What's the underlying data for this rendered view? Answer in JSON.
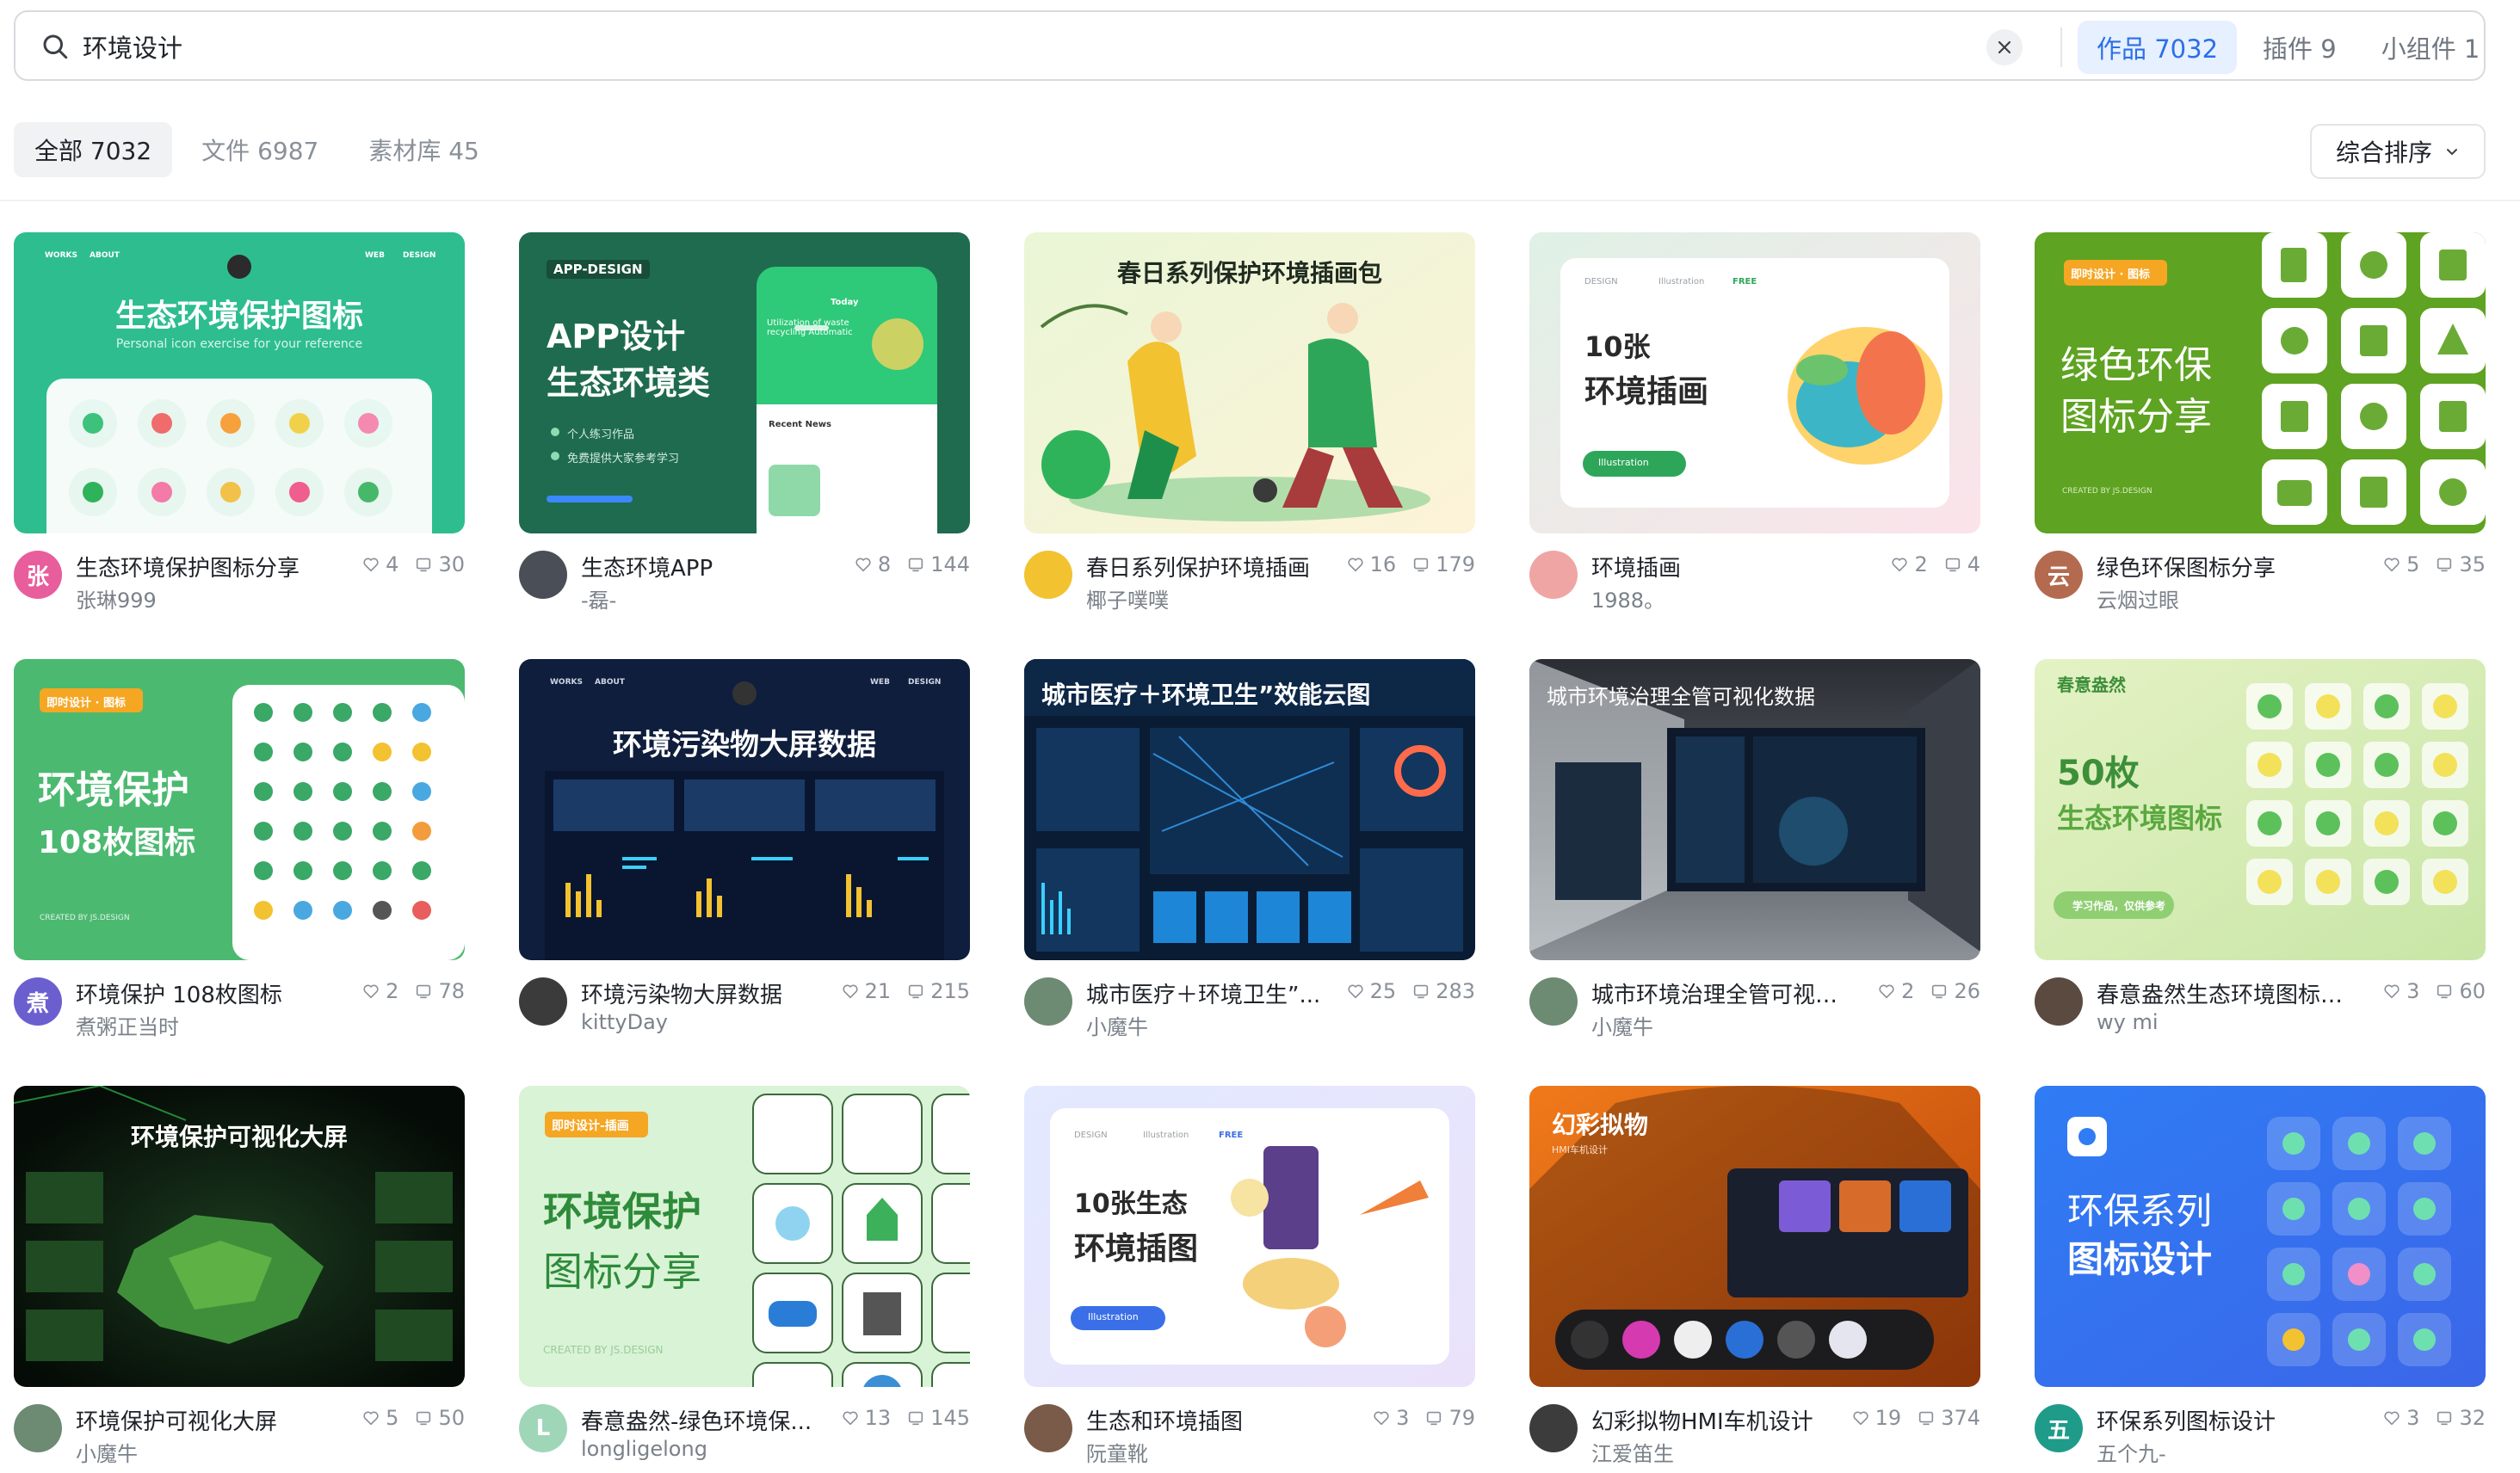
{
  "search": {
    "value": "环境设计",
    "placeholder": ""
  },
  "type_tabs": [
    {
      "label": "作品 7032",
      "active": true
    },
    {
      "label": "插件 9",
      "active": false
    },
    {
      "label": "小组件 1",
      "active": false
    }
  ],
  "filter_tabs": [
    {
      "label": "全部 7032",
      "active": true
    },
    {
      "label": "文件 6987",
      "active": false
    },
    {
      "label": "素材库 45",
      "active": false
    }
  ],
  "sort": {
    "label": "综合排序"
  },
  "colors": {
    "accent": "#2b6fe8",
    "accent_bg": "#e6f0ff"
  },
  "cards": [
    {
      "title": "生态环境保护图标分享",
      "author": "张琳999",
      "likes": "4",
      "comments": "30",
      "avatar_text": "张",
      "avatar_color": "#e85d9c",
      "thumb": {
        "heading": "生态环境保护图标",
        "sub": "Personal icon exercise for your reference",
        "nav": [
          "WORKS",
          "ABOUT",
          "WEB",
          "DESIGN"
        ]
      }
    },
    {
      "title": "生态环境APP",
      "author": "-磊-",
      "likes": "8",
      "comments": "144",
      "avatar_text": "",
      "avatar_color": "#4a4f57",
      "thumb": {
        "tag": "APP-DESIGN",
        "heading_1": "APP设计",
        "heading_2": "生态环境类",
        "bullet_1": "个人练习作品",
        "bullet_2": "免费提供大家参考学习",
        "phone_top": "Today",
        "phone_text": "Utilization of waste recycling Automatic",
        "phone_news": "Recent News"
      }
    },
    {
      "title": "春日系列保护环境插画",
      "author": "椰子噗噗",
      "likes": "16",
      "comments": "179",
      "avatar_text": "",
      "avatar_color": "#f2c230",
      "thumb": {
        "heading": "春日系列保护环境插画包"
      }
    },
    {
      "title": "环境插画",
      "author": "1988。",
      "likes": "2",
      "comments": "4",
      "avatar_text": "",
      "avatar_color": "#f0a5a5",
      "thumb": {
        "nav": [
          "DESIGN",
          "Illustration",
          "FREE"
        ],
        "heading_1": "10张",
        "heading_2": "环境插画",
        "button": "Illustration"
      }
    },
    {
      "title": "绿色环保图标分享",
      "author": "云烟过眼",
      "likes": "5",
      "comments": "35",
      "avatar_text": "云",
      "avatar_color": "#b36a4f",
      "thumb": {
        "tag": "即时设计 · 图标",
        "heading_1": "绿色环保",
        "heading_2": "图标分享",
        "footer": "CREATED BY JS.DESIGN"
      }
    },
    {
      "title": "环境保护 108枚图标",
      "author": "煮粥正当时",
      "likes": "2",
      "comments": "78",
      "avatar_text": "煮",
      "avatar_color": "#6b5fd0",
      "thumb": {
        "tag": "即时设计 · 图标",
        "heading_1": "环境保护",
        "heading_2": "108枚图标",
        "footer": "CREATED BY JS.DESIGN"
      }
    },
    {
      "title": "环境污染物大屏数据",
      "author": "kittyDay",
      "likes": "21",
      "comments": "215",
      "avatar_text": "",
      "avatar_color": "#3b3b3b",
      "thumb": {
        "heading": "环境污染物大屏数据",
        "nav": [
          "WORKS",
          "ABOUT",
          "WEB",
          "DESIGN"
        ]
      }
    },
    {
      "title": "城市医疗＋环境卫生”...",
      "author": "小魔牛",
      "likes": "25",
      "comments": "283",
      "avatar_text": "",
      "avatar_color": "#6d8a72",
      "thumb": {
        "heading": "城市医疗＋环境卫生”效能云图"
      }
    },
    {
      "title": "城市环境治理全管可视化...",
      "author": "小魔牛",
      "likes": "2",
      "comments": "26",
      "avatar_text": "",
      "avatar_color": "#6d8a72",
      "thumb": {
        "heading": "城市环境治理全管可视化数据"
      }
    },
    {
      "title": "春意盎然生态环境图标合集",
      "author": "wy mi",
      "likes": "3",
      "comments": "60",
      "avatar_text": "",
      "avatar_color": "#5a4a3f",
      "thumb": {
        "tag": "春意盎然",
        "heading_1": "50枚",
        "heading_2": "生态环境图标",
        "button": "学习作品，仅供参考"
      }
    },
    {
      "title": "环境保护可视化大屏",
      "author": "小魔牛",
      "likes": "5",
      "comments": "50",
      "avatar_text": "",
      "avatar_color": "#6d8a72",
      "thumb": {
        "heading": "环境保护可视化大屏"
      }
    },
    {
      "title": "春意盎然-绿色环境保...",
      "author": "longligelong",
      "likes": "13",
      "comments": "145",
      "avatar_text": "L",
      "avatar_color": "#9fd6b8",
      "thumb": {
        "tag": "即时设计-插画",
        "heading_1": "环境保护",
        "heading_2": "图标分享",
        "footer": "CREATED BY JS.DESIGN"
      }
    },
    {
      "title": "生态和环境插图",
      "author": "阮童靴",
      "likes": "3",
      "comments": "79",
      "avatar_text": "",
      "avatar_color": "#7a5a48",
      "thumb": {
        "nav": [
          "DESIGN",
          "Illustration",
          "FREE"
        ],
        "heading_1": "10张生态",
        "heading_2": "环境插图",
        "button": "Illustration"
      }
    },
    {
      "title": "幻彩拟物HMI车机设计",
      "author": "江爱笛生",
      "likes": "19",
      "comments": "374",
      "avatar_text": "",
      "avatar_color": "#3c3c3c",
      "thumb": {
        "heading": "幻彩拟物",
        "sub": "HMI车机设计"
      }
    },
    {
      "title": "环保系列图标设计",
      "author": "五个九-",
      "likes": "3",
      "comments": "32",
      "avatar_text": "五",
      "avatar_color": "#1f9b8a",
      "thumb": {
        "heading_1": "环保系列",
        "heading_2": "图标设计"
      }
    }
  ]
}
